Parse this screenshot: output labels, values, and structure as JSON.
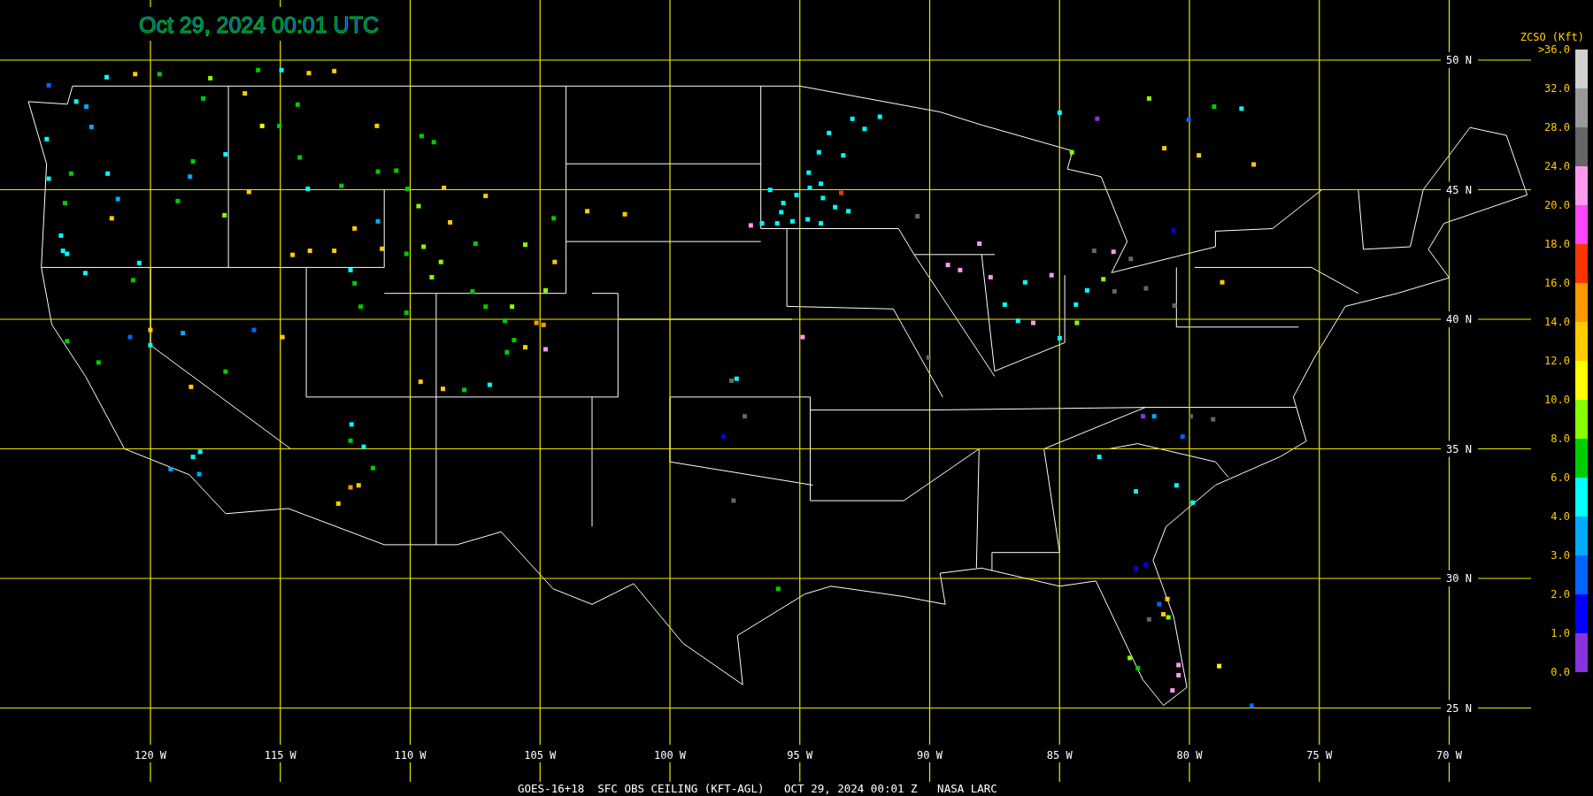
{
  "title": "Oct 29, 2024 00:01 UTC",
  "latitude_labels": [
    "50 N",
    "45 N",
    "40 N",
    "35 N",
    "30 N",
    "25 N"
  ],
  "longitude_labels": [
    "120 W",
    "115 W",
    "110 W",
    "105 W",
    "100 W",
    "95 W",
    "90 W",
    "85 W",
    "80 W",
    "75 W",
    "70 W"
  ],
  "legend": {
    "title": "ZCSO (Kft)",
    "labels": [
      ">36.0",
      "32.0",
      "28.0",
      "24.0",
      "20.0",
      "18.0",
      "16.0",
      "14.0",
      "12.0",
      "10.0",
      "8.0",
      "6.0",
      "4.0",
      "3.0",
      "2.0",
      "1.0",
      "0.0"
    ],
    "bands": [
      {
        "color": "#d0d0d0"
      },
      {
        "color": "#999999"
      },
      {
        "color": "#666666"
      },
      {
        "color": "#ff99ee"
      },
      {
        "color": "#ff44ff"
      },
      {
        "color": "#ff3300"
      },
      {
        "color": "#ff9900"
      },
      {
        "color": "#ffcc00"
      },
      {
        "color": "#ffff00"
      },
      {
        "color": "#88ff00"
      },
      {
        "color": "#00cc00"
      },
      {
        "color": "#00ffff"
      },
      {
        "color": "#00aaff"
      },
      {
        "color": "#0066ff"
      },
      {
        "color": "#0000ff"
      },
      {
        "color": "#8833dd"
      }
    ]
  },
  "caption": "GOES-16+18  SFC OBS CEILING (KFT-AGL)   OCT 29, 2024 00:01 Z   NASA LARC"
}
